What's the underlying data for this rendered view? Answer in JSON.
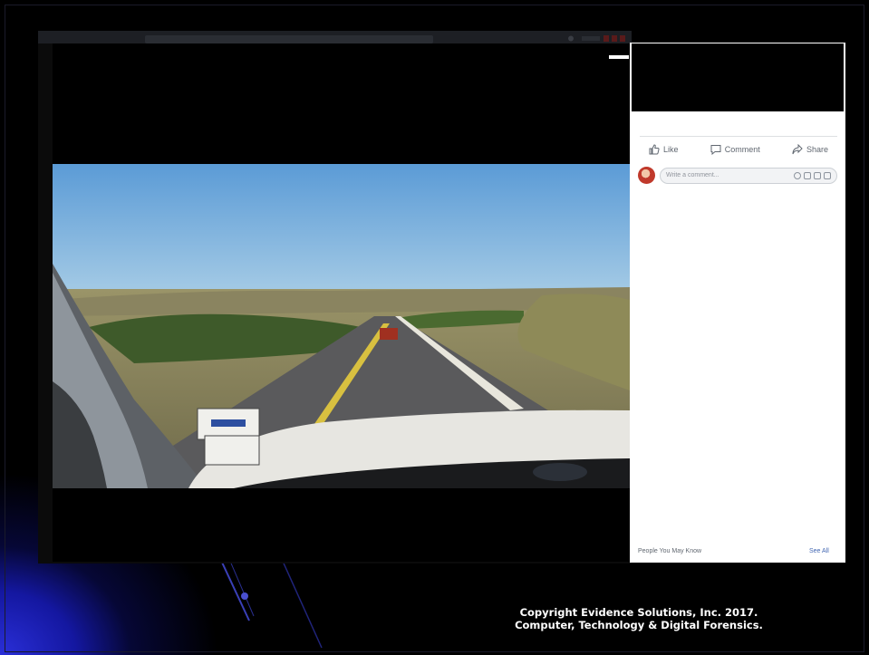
{
  "facebook_panel": {
    "actions": {
      "like_label": "Like",
      "comment_label": "Comment",
      "share_label": "Share"
    },
    "comment_input": {
      "placeholder": "Write a comment..."
    },
    "people_you_may_know": {
      "heading": "People You May Know",
      "see_all_label": "See All"
    }
  },
  "slide": {
    "copyright_line1": "Copyright Evidence Solutions, Inc. 2017.",
    "copyright_line2": "Computer, Technology & Digital Forensics."
  },
  "colors": {
    "slide_background": "#000000",
    "slide_accent_blue": "#2a2fd8",
    "link_blue": "#4267b2",
    "muted_text": "#606770"
  },
  "icons": [
    "like-icon",
    "comment-icon",
    "share-icon",
    "emoji-icon",
    "camera-icon",
    "gif-icon",
    "sticker-icon",
    "close-icon"
  ]
}
